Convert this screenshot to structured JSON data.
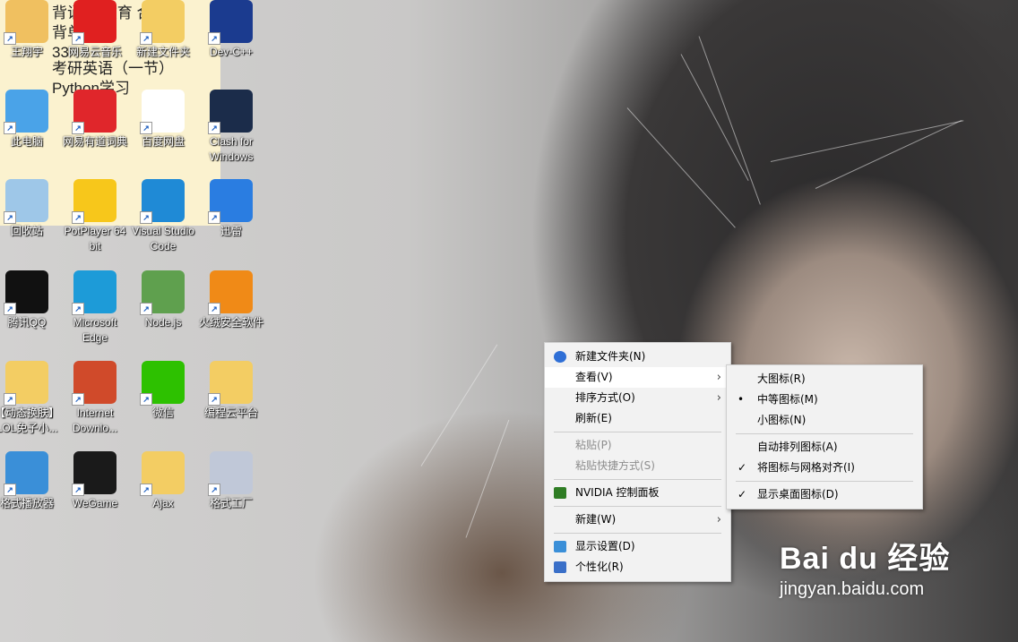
{
  "notepad_lines": [
    "背诵  （教育  合）",
    "背单",
    "33    ",
    "考研英语（一节）",
    "Python学习"
  ],
  "desktop_icons": [
    {
      "label": "王翔宇",
      "icon": "user-folder-icon",
      "color": "#f0c060"
    },
    {
      "label": "网易云音乐",
      "icon": "netease-music-icon",
      "color": "#e02020"
    },
    {
      "label": "新建文件夹",
      "icon": "folder-icon",
      "color": "#f3cd63"
    },
    {
      "label": "Dev-C++",
      "icon": "dev-cpp-icon",
      "color": "#1b3b8f"
    },
    {
      "label": "此电脑",
      "icon": "computer-icon",
      "color": "#4aa3e8"
    },
    {
      "label": "网易有道词典",
      "icon": "youdao-icon",
      "color": "#e0262b"
    },
    {
      "label": "百度网盘",
      "icon": "baidu-netdisk-icon",
      "color": "#ffffff"
    },
    {
      "label": "Clash for Windows",
      "icon": "clash-icon",
      "color": "#1b2c4a"
    },
    {
      "label": "回收站",
      "icon": "recycle-bin-icon",
      "color": "#9ec7e8"
    },
    {
      "label": "PotPlayer 64 bit",
      "icon": "potplayer-icon",
      "color": "#f7c71b"
    },
    {
      "label": "Visual Studio Code",
      "icon": "vscode-icon",
      "color": "#1f8ad6"
    },
    {
      "label": "迅雷",
      "icon": "xunlei-icon",
      "color": "#2a7de1"
    },
    {
      "label": "腾讯QQ",
      "icon": "qq-icon",
      "color": "#111111"
    },
    {
      "label": "Microsoft Edge",
      "icon": "edge-icon",
      "color": "#1d9bd8"
    },
    {
      "label": "Node.js",
      "icon": "nodejs-icon",
      "color": "#5fa04e"
    },
    {
      "label": "火绒安全软件",
      "icon": "huorong-icon",
      "color": "#f08a17"
    },
    {
      "label": "【动态换肤】LOL免子小...",
      "icon": "folder-icon",
      "color": "#f3cd63"
    },
    {
      "label": "Internet Downlo...",
      "icon": "idm-icon",
      "color": "#d04a2a"
    },
    {
      "label": "微信",
      "icon": "wechat-icon",
      "color": "#2dc100"
    },
    {
      "label": "编程云平台",
      "icon": "folder-icon",
      "color": "#f3cd63"
    },
    {
      "label": "格式播放器",
      "icon": "player-icon",
      "color": "#3a8fd8"
    },
    {
      "label": "WeGame",
      "icon": "wegame-icon",
      "color": "#1a1a1a"
    },
    {
      "label": "Ajax",
      "icon": "folder-icon",
      "color": "#f3cd63"
    },
    {
      "label": "格式工厂",
      "icon": "format-factory-icon",
      "color": "#c0c8d8"
    }
  ],
  "context_menu": {
    "items": [
      {
        "label": "新建文件夹(N)",
        "icon": "new-folder-icon",
        "disabled": false,
        "submenu": false
      },
      {
        "label": "查看(V)",
        "icon": "",
        "disabled": false,
        "submenu": true,
        "hover": true
      },
      {
        "label": "排序方式(O)",
        "icon": "",
        "disabled": false,
        "submenu": true
      },
      {
        "label": "刷新(E)",
        "icon": "",
        "disabled": false,
        "submenu": false
      },
      {
        "separator": true
      },
      {
        "label": "粘贴(P)",
        "icon": "",
        "disabled": true,
        "submenu": false
      },
      {
        "label": "粘贴快捷方式(S)",
        "icon": "",
        "disabled": true,
        "submenu": false
      },
      {
        "separator": true
      },
      {
        "label": "NVIDIA 控制面板",
        "icon": "nvidia-icon",
        "disabled": false,
        "submenu": false
      },
      {
        "separator": true
      },
      {
        "label": "新建(W)",
        "icon": "",
        "disabled": false,
        "submenu": true
      },
      {
        "separator": true
      },
      {
        "label": "显示设置(D)",
        "icon": "display-settings-icon",
        "disabled": false,
        "submenu": false
      },
      {
        "label": "个性化(R)",
        "icon": "personalize-icon",
        "disabled": false,
        "submenu": false
      }
    ]
  },
  "view_submenu": {
    "items": [
      {
        "label": "大图标(R)",
        "mark": ""
      },
      {
        "label": "中等图标(M)",
        "mark": "•"
      },
      {
        "label": "小图标(N)",
        "mark": ""
      },
      {
        "separator": true
      },
      {
        "label": "自动排列图标(A)",
        "mark": ""
      },
      {
        "label": "将图标与网格对齐(I)",
        "mark": "✓"
      },
      {
        "separator": true
      },
      {
        "label": "显示桌面图标(D)",
        "mark": "✓"
      }
    ]
  },
  "watermark": {
    "brand": "Bai du 经验",
    "domain": "jingyan.baidu.com"
  },
  "colors": {
    "menu_bg": "#f2f2f2",
    "menu_hover": "#ffffff",
    "note_bg": "#fbf2cf"
  }
}
